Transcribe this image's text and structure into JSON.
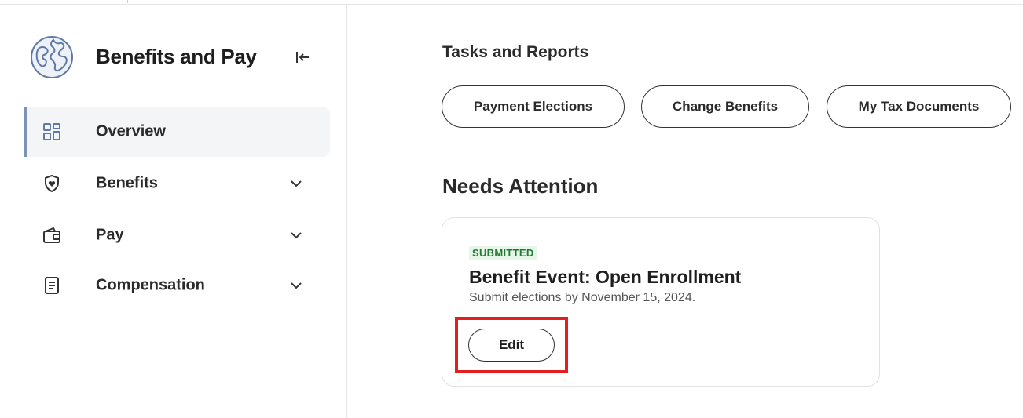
{
  "sidebar": {
    "title": "Benefits and Pay",
    "logo_icon": "globe-icon",
    "collapse_icon": "collapse-left-icon",
    "items": [
      {
        "label": "Overview",
        "icon": "grid-icon",
        "active": true,
        "expandable": false
      },
      {
        "label": "Benefits",
        "icon": "shield-heart-icon",
        "active": false,
        "expandable": true
      },
      {
        "label": "Pay",
        "icon": "wallet-icon",
        "active": false,
        "expandable": true
      },
      {
        "label": "Compensation",
        "icon": "document-icon",
        "active": false,
        "expandable": true
      }
    ]
  },
  "tasks": {
    "title": "Tasks and Reports",
    "buttons": [
      {
        "label": "Payment Elections"
      },
      {
        "label": "Change Benefits"
      },
      {
        "label": "My Tax Documents"
      }
    ]
  },
  "needs_attention": {
    "title": "Needs Attention",
    "card": {
      "status": "SUBMITTED",
      "title": "Benefit Event: Open Enrollment",
      "subtitle": "Submit elections by November 15, 2024.",
      "action_label": "Edit"
    }
  },
  "colors": {
    "accent": "#7d93b5",
    "highlight": "#e41e1e",
    "badge_text": "#1f7a34",
    "badge_bg": "#e8f6ea"
  }
}
